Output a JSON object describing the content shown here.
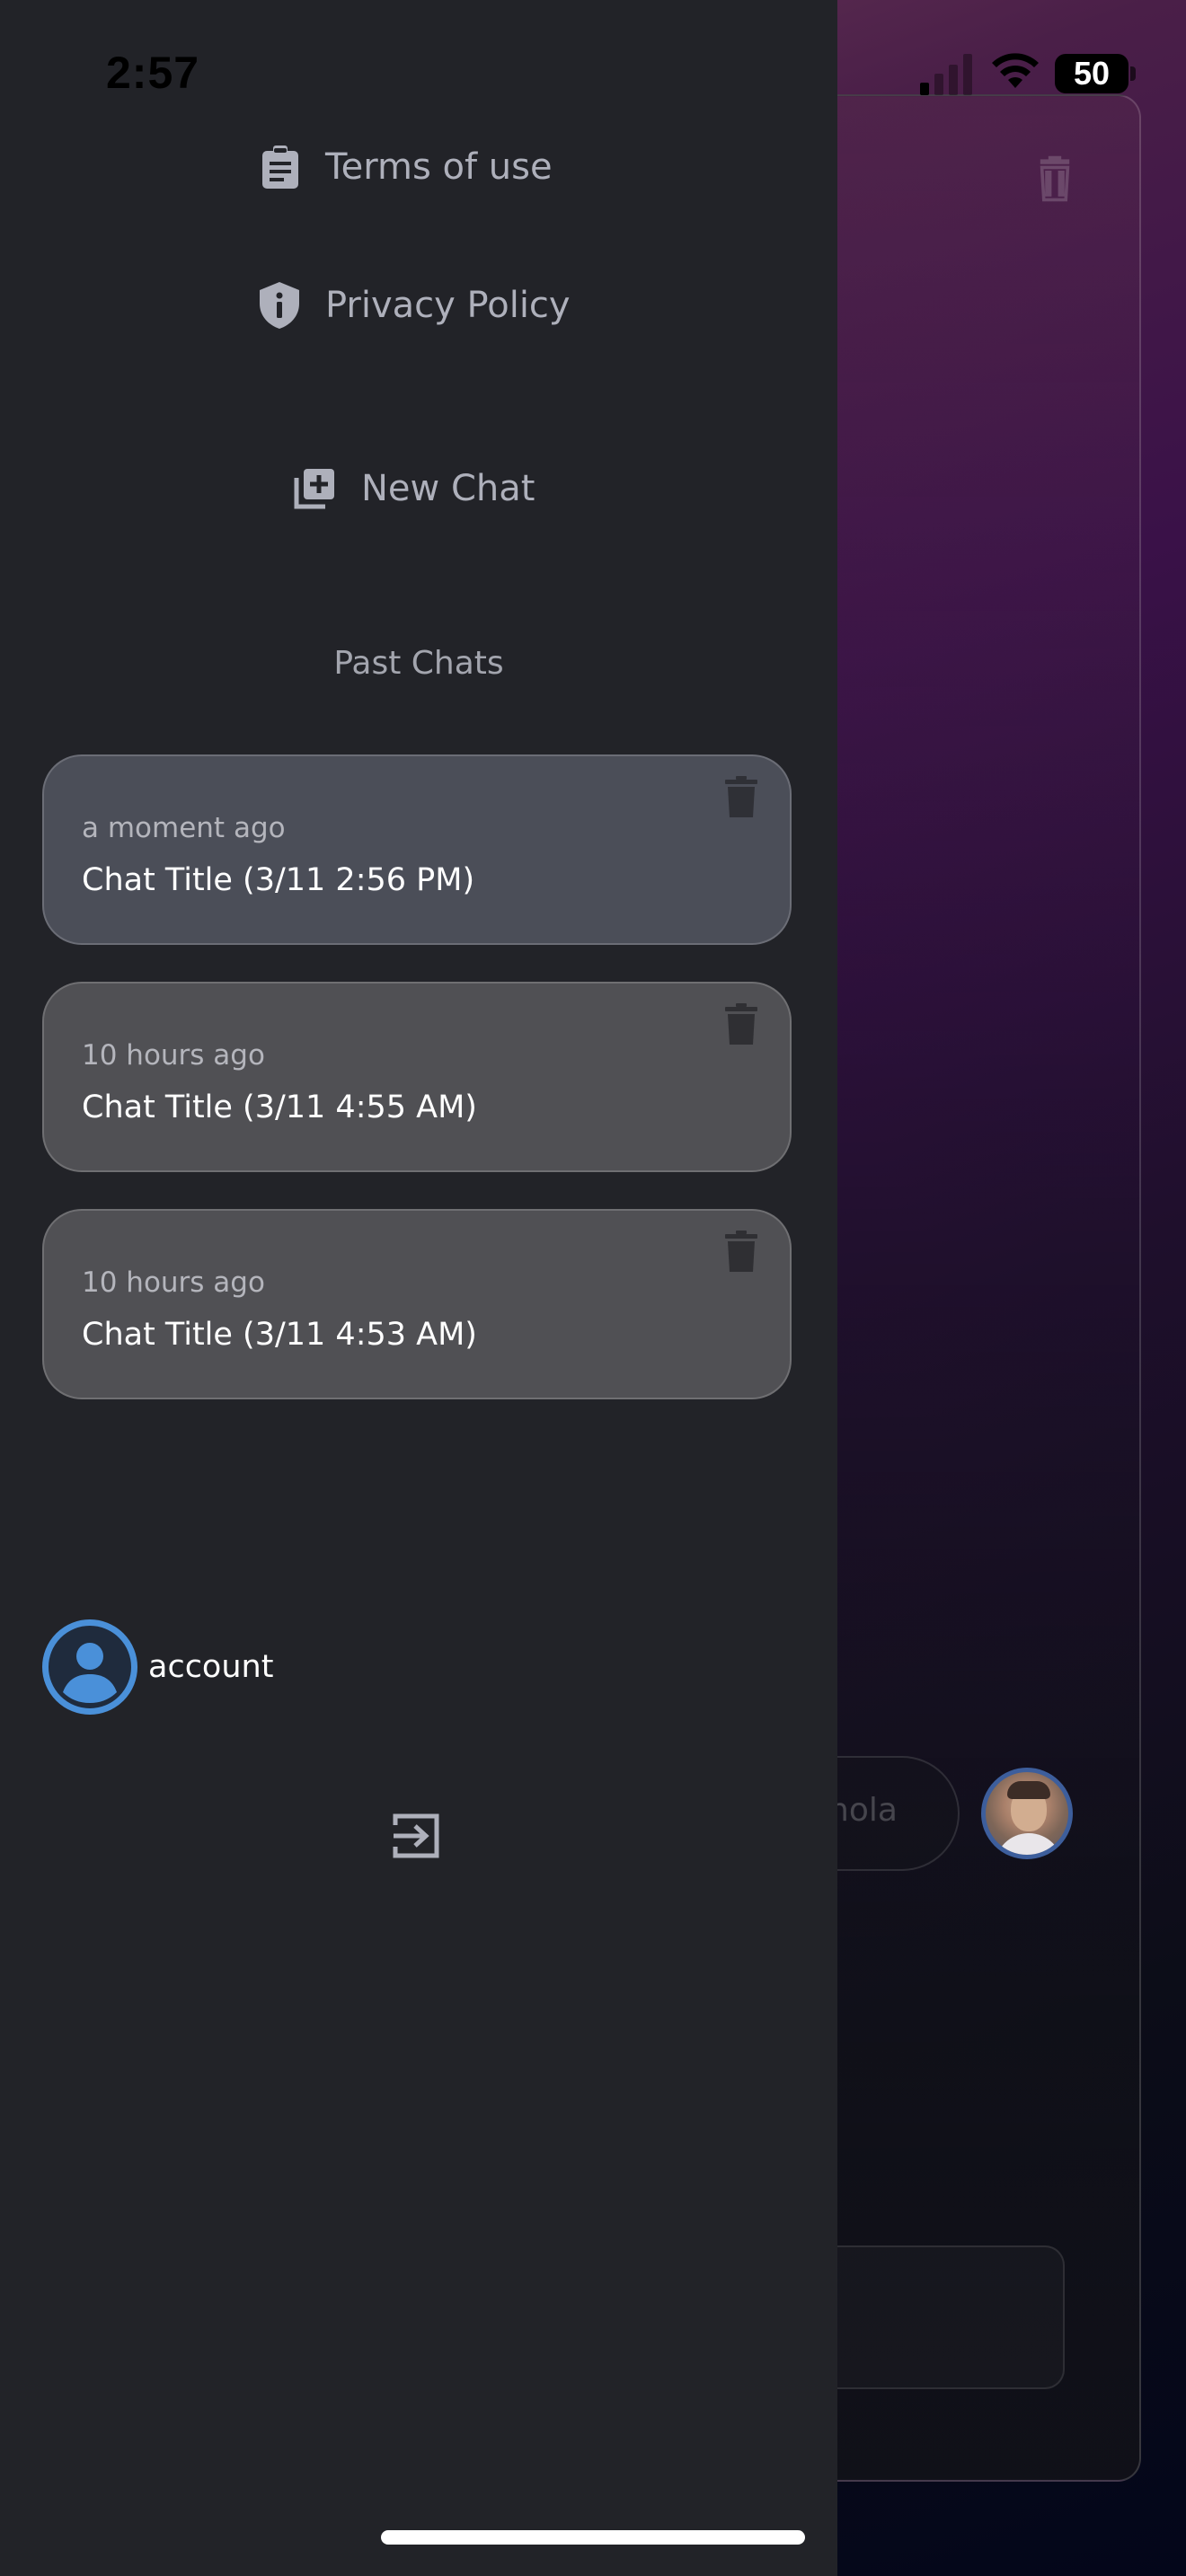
{
  "status_bar": {
    "time": "2:57",
    "battery": "50"
  },
  "drawer": {
    "menu": {
      "terms_label": "Terms of use",
      "privacy_label": "Privacy Policy",
      "new_chat_label": "New Chat"
    },
    "past_chats_title": "Past Chats",
    "past_chats": [
      {
        "time": "a moment ago",
        "title": "Chat Title (3/11 2:56 PM)",
        "active": true
      },
      {
        "time": "10 hours ago",
        "title": "Chat Title (3/11 4:55 AM)",
        "active": false
      },
      {
        "time": "10 hours ago",
        "title": "Chat Title (3/11 4:53 AM)",
        "active": false
      }
    ],
    "account_label": "account"
  },
  "background": {
    "message_text": "hola"
  },
  "colors": {
    "drawer_bg": "#222328",
    "card_bg": "#505054",
    "active_card_bg": "#4b4e58",
    "menu_text": "#aeb0bb",
    "account_ring": "#4a90d9"
  }
}
